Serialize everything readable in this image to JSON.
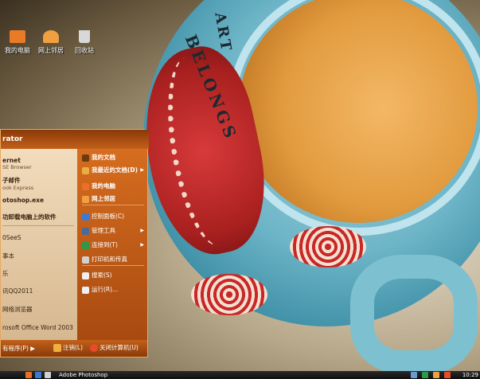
{
  "desktop": {
    "icons": [
      {
        "label": "我的电脑",
        "icon": "my-computer-icon"
      },
      {
        "label": "网上邻居",
        "icon": "network-places-icon"
      },
      {
        "label": "回收站",
        "icon": "recycle-bin-icon"
      }
    ]
  },
  "wallpaper": {
    "text_line1": "ART",
    "text_line2": "BELONGS"
  },
  "start_menu": {
    "header_user": "rator",
    "left": {
      "pinned": [
        {
          "title": "ernet",
          "subtitle": "SE Browser"
        },
        {
          "title": "子邮件",
          "subtitle": "ook Express"
        },
        {
          "title": "otoshop.exe",
          "subtitle": ""
        },
        {
          "title": "功卸载电脑上的软件",
          "subtitle": ""
        }
      ],
      "recent": [
        "0SeeS",
        "事本",
        "乐",
        "讯QQ2011",
        "网络浏览器",
        "rosoft Office Word 2003"
      ],
      "all_programs": "有程序(P)"
    },
    "right": {
      "items": [
        {
          "label": "我的文档",
          "bold": true,
          "arrow": false,
          "icon": "my-documents-icon",
          "color": "#6a3a14"
        },
        {
          "label": "我最近的文档(D)",
          "bold": true,
          "arrow": true,
          "icon": "recent-documents-icon",
          "color": "#e8b040"
        },
        {
          "label": "我的电脑",
          "bold": true,
          "arrow": false,
          "icon": "my-computer-icon",
          "color": "#e8702a"
        },
        {
          "label": "网上邻居",
          "bold": true,
          "arrow": false,
          "icon": "network-places-icon",
          "color": "#f0a040"
        },
        {
          "label": "控制面板(C)",
          "bold": false,
          "arrow": false,
          "icon": "control-panel-icon",
          "color": "#3a7ad0"
        },
        {
          "label": "管理工具",
          "bold": false,
          "arrow": true,
          "icon": "admin-tools-icon",
          "color": "#4a6a9a"
        },
        {
          "label": "连接到(T)",
          "bold": false,
          "arrow": true,
          "icon": "connect-to-icon",
          "color": "#2a9a4a"
        },
        {
          "label": "打印机和传真",
          "bold": false,
          "arrow": false,
          "icon": "printer-icon",
          "color": "#d0d0d0"
        },
        {
          "label": "搜索(S)",
          "bold": false,
          "arrow": false,
          "icon": "search-icon",
          "color": "#f0f0f0"
        },
        {
          "label": "运行(R)...",
          "bold": false,
          "arrow": false,
          "icon": "run-icon",
          "color": "#f0f0f0"
        }
      ]
    },
    "footer": {
      "logoff": "注销(L)",
      "shutdown": "关闭计算机(U)"
    }
  },
  "taskbar": {
    "task_label": "Adobe Photoshop",
    "clock": "10:29"
  }
}
